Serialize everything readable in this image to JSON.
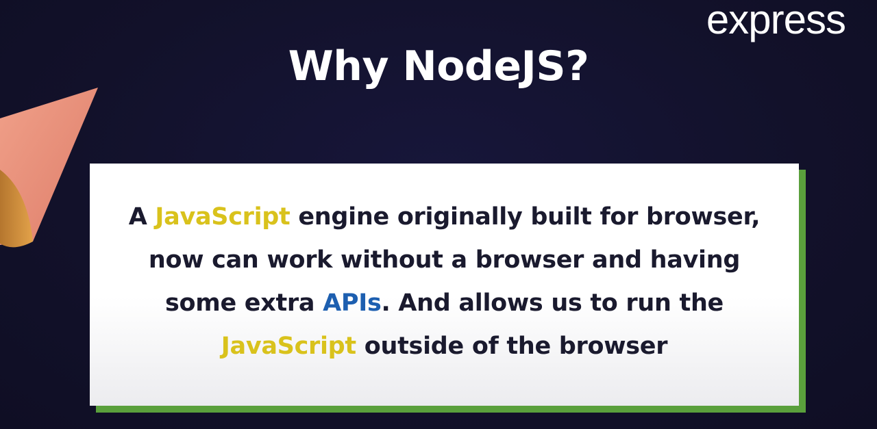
{
  "brand": {
    "text": "express"
  },
  "slide": {
    "title": "Why NodeJS?",
    "body": {
      "line1_a": "A ",
      "line1_hl": "JavaScript",
      "line1_b": " engine originally built for browser,",
      "line2": "now can work without a browser and having",
      "line3_a": "some extra ",
      "line3_hl": "APIs",
      "line3_b": ". And allows us to run the",
      "line4_hl": "JavaScript",
      "line4_b": " outside of the browser"
    }
  },
  "colors": {
    "background": "#13122b",
    "highlight_yellow": "#d9c21c",
    "highlight_blue": "#1d5fb0",
    "card_shadow": "#5aa03c",
    "decoration": "#e58b76"
  },
  "icons": {
    "decoration": "cone-shape-decoration"
  }
}
